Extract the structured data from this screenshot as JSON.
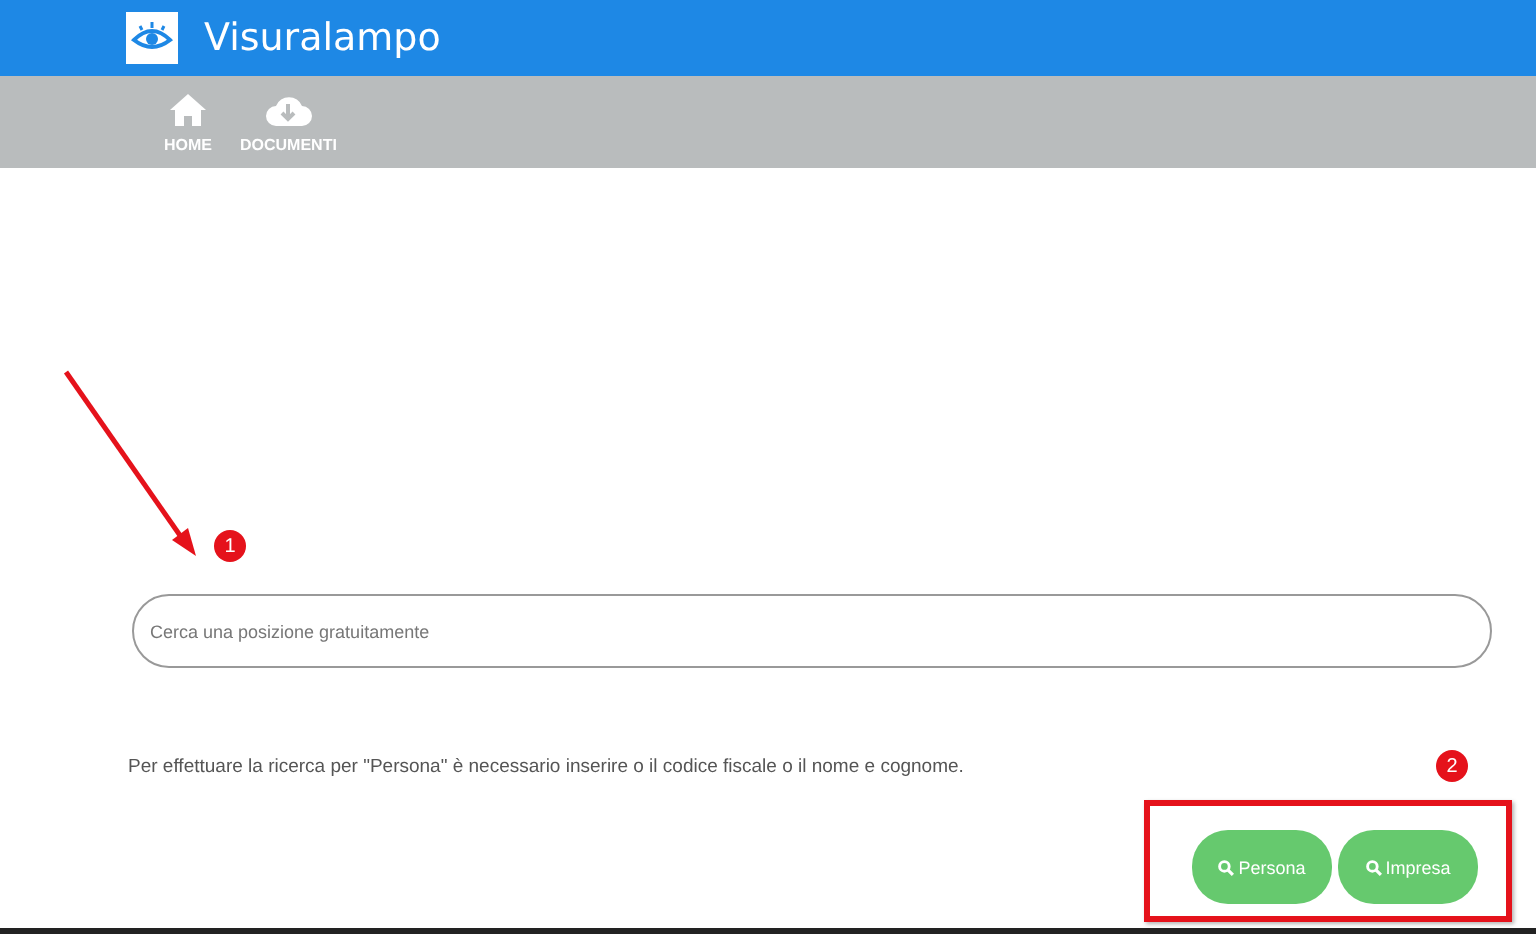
{
  "header": {
    "title": "Visuralampo"
  },
  "nav": [
    {
      "label": "HOME",
      "kind": "home"
    },
    {
      "label": "DOCUMENTI",
      "kind": "download"
    }
  ],
  "search": {
    "placeholder": "Cerca una posizione gratuitamente"
  },
  "note": "Per effettuare la ricerca per \"Persona\" è necessario inserire o il codice fiscale o il nome e cognome.",
  "buttons": [
    {
      "label": "Persona"
    },
    {
      "label": "Impresa"
    }
  ],
  "annotations": [
    {
      "label": "1"
    },
    {
      "label": "2"
    }
  ]
}
